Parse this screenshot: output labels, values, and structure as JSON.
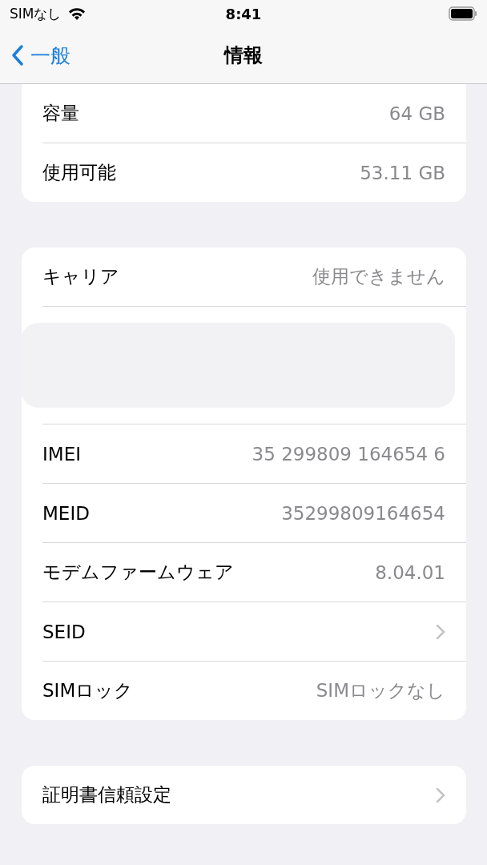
{
  "status_bar": {
    "carrier": "SIMなし",
    "time": "8:41"
  },
  "nav": {
    "back": "一般",
    "title": "情報"
  },
  "groups": [
    {
      "rows": [
        {
          "kind": "value",
          "label": "容量",
          "value": "64 GB"
        },
        {
          "kind": "value",
          "label": "使用可能",
          "value": "53.11 GB"
        }
      ]
    },
    {
      "rows": [
        {
          "kind": "value",
          "label": "キャリア",
          "value": "使用できません"
        },
        {
          "kind": "redacted"
        },
        {
          "kind": "value",
          "label": "IMEI",
          "value": "35 299809 164654 6"
        },
        {
          "kind": "value",
          "label": "MEID",
          "value": "35299809164654"
        },
        {
          "kind": "value",
          "label": "モデムファームウェア",
          "value": "8.04.01"
        },
        {
          "kind": "link",
          "label": "SEID"
        },
        {
          "kind": "value",
          "label": "SIMロック",
          "value": "SIMロックなし"
        }
      ]
    },
    {
      "rows": [
        {
          "kind": "link",
          "label": "証明書信頼設定"
        }
      ]
    }
  ]
}
